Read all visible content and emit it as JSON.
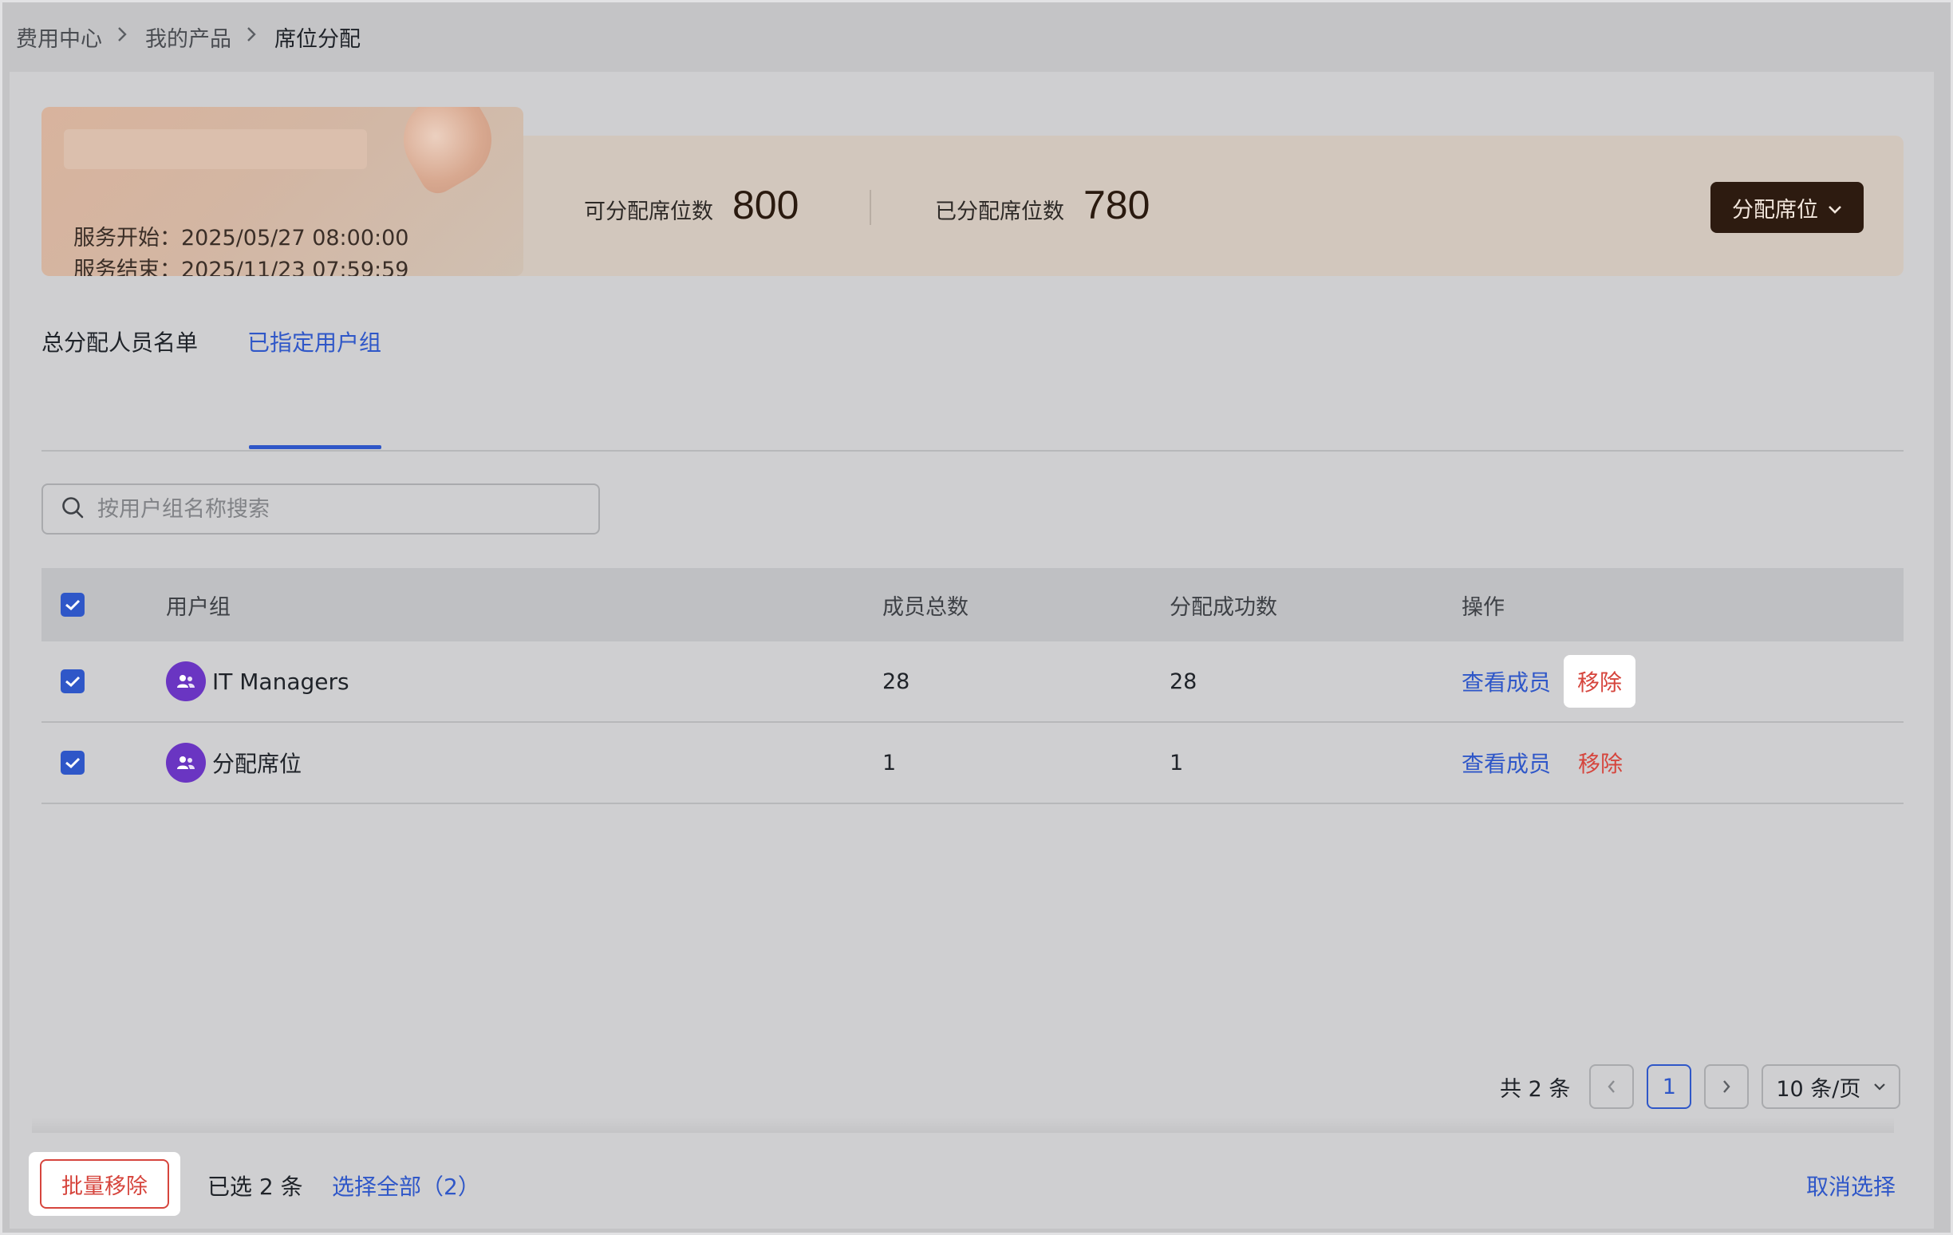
{
  "breadcrumb": {
    "items": [
      "费用中心",
      "我的产品"
    ],
    "current": "席位分配"
  },
  "service": {
    "start_label": "服务开始：",
    "start_value": "2025/05/27 08:00:00",
    "end_label": "服务结束：",
    "end_value": "2025/11/23 07:59:59"
  },
  "stats": {
    "available_label": "可分配席位数",
    "available_value": "800",
    "assigned_label": "已分配席位数",
    "assigned_value": "780"
  },
  "assign_button": "分配席位",
  "tabs": [
    {
      "label": "总分配人员名单",
      "active": false
    },
    {
      "label": "已指定用户组",
      "active": true
    }
  ],
  "search": {
    "placeholder": "按用户组名称搜索",
    "value": ""
  },
  "table": {
    "headers": {
      "group": "用户组",
      "members": "成员总数",
      "success": "分配成功数",
      "ops": "操作"
    },
    "rows": [
      {
        "name": "IT Managers",
        "members": "28",
        "success": "28",
        "view": "查看成员",
        "remove": "移除",
        "checked": true
      },
      {
        "name": "分配席位",
        "members": "1",
        "success": "1",
        "view": "查看成员",
        "remove": "移除",
        "checked": true
      }
    ]
  },
  "pagination": {
    "total": "共 2 条",
    "current_page": "1",
    "page_size": "10 条/页"
  },
  "bottom": {
    "batch_remove": "批量移除",
    "selected": "已选 2 条",
    "select_all": "选择全部（2）",
    "cancel": "取消选择"
  },
  "colors": {
    "accent": "#2f57c8",
    "danger": "#d6453d",
    "brand_dark": "#2d1b10",
    "avatar": "#6a35c2"
  }
}
